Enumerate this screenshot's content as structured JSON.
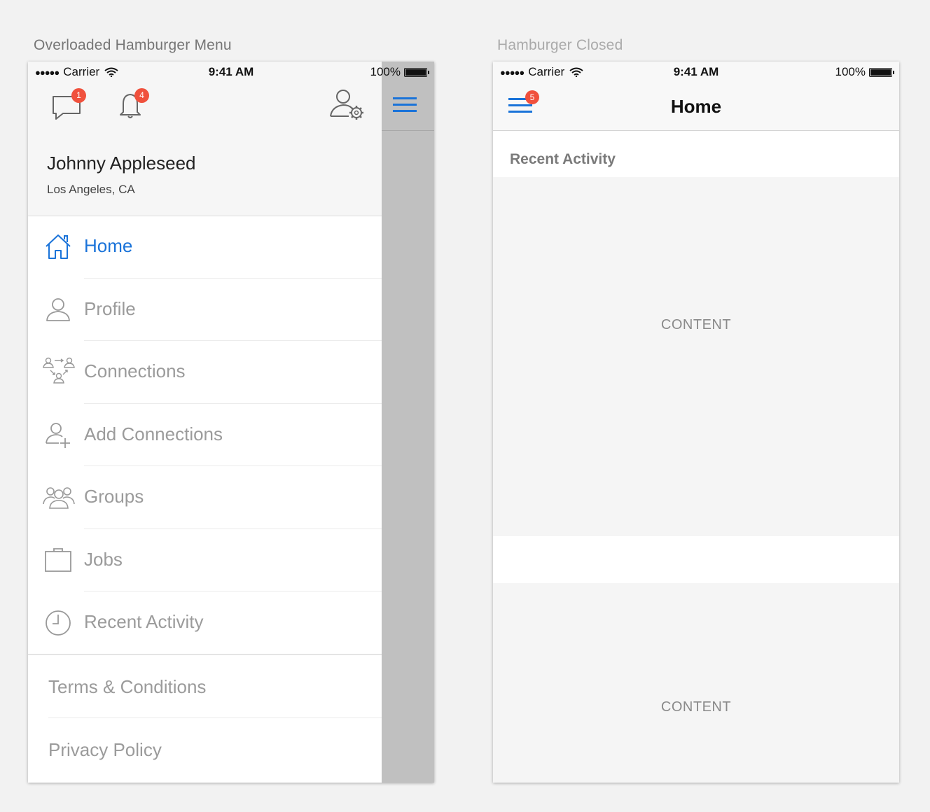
{
  "captions": {
    "left": "Overloaded Hamburger Menu",
    "right": "Hamburger Closed"
  },
  "status_bar": {
    "signal": "●●●●●",
    "carrier": "Carrier",
    "time": "9:41 AM",
    "battery": "100%"
  },
  "drawer": {
    "header_icons": [
      {
        "name": "messages-icon",
        "badge": "1"
      },
      {
        "name": "bell-icon",
        "badge": "4"
      },
      {
        "name": "user-settings-icon"
      }
    ],
    "user": {
      "name": "Johnny Appleseed",
      "location": "Los Angeles, CA"
    },
    "menu": [
      {
        "label": "Home",
        "icon": "home-icon",
        "active": true
      },
      {
        "label": "Profile",
        "icon": "person-icon"
      },
      {
        "label": "Connections",
        "icon": "connections-icon"
      },
      {
        "label": "Add Connections",
        "icon": "add-person-icon"
      },
      {
        "label": "Groups",
        "icon": "groups-icon"
      },
      {
        "label": "Jobs",
        "icon": "briefcase-icon"
      },
      {
        "label": "Recent Activity",
        "icon": "clock-icon"
      }
    ],
    "footer": [
      {
        "label": "Terms & Conditions"
      },
      {
        "label": "Privacy Policy"
      }
    ]
  },
  "home": {
    "title": "Home",
    "hamburger_badge": "5",
    "section_header": "Recent Activity",
    "content_blocks": [
      "CONTENT",
      "CONTENT"
    ]
  },
  "colors": {
    "accent": "#1a73d9",
    "badge": "#f0513d",
    "inactive_text": "#9b9b9b",
    "dim_overlay": "#c0c0c0"
  }
}
